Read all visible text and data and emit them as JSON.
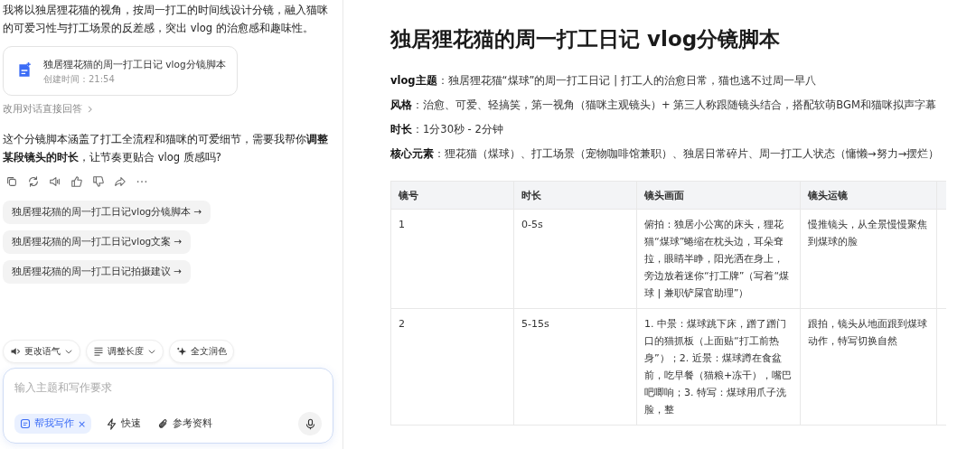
{
  "chat": {
    "intro": "我将以独居狸花猫的视角，按周一打工的时间线设计分镜，融入猫咪的可爱习性与打工场景的反差感，突出 vlog 的治愈感和趣味性。",
    "doc_card": {
      "title": "独居狸花猫的周一打工日记 vlog分镜脚本",
      "created": "创建时间：21:54"
    },
    "switch_link": "改用对话直接回答",
    "followup": "这个分镜脚本涵盖了打工全流程和猫咪的可爱细节，需要我帮你**调整某段镜头的时长**，让节奏更贴合 vlog 质感吗?",
    "actions": [
      {
        "kind": "copy"
      },
      {
        "kind": "regenerate"
      },
      {
        "kind": "speak"
      },
      {
        "kind": "like"
      },
      {
        "kind": "dislike"
      },
      {
        "kind": "share"
      },
      {
        "kind": "more"
      }
    ],
    "suggestions": [
      "独居狸花猫的周一打工日记vlog分镜脚本 →",
      "独居狸花猫的周一打工日记vlog文案 →",
      "独居狸花猫的周一打工日记拍摄建议 →"
    ]
  },
  "tools": [
    {
      "kind": "tone",
      "label": "更改语气"
    },
    {
      "kind": "length",
      "label": "调整长度"
    },
    {
      "kind": "polish",
      "label": "全文润色"
    }
  ],
  "composer": {
    "placeholder": "输入主题和写作要求",
    "mode_tag": {
      "label": "帮我写作",
      "close": "×"
    },
    "options": [
      {
        "kind": "fast",
        "label": "快速"
      },
      {
        "kind": "attach",
        "label": "参考资料"
      }
    ]
  },
  "document": {
    "title": "独居狸花猫的周一打工日记 vlog分镜脚本",
    "meta": [
      "**vlog主题**：独居狸花猫“煤球”的周一打工日记 | 打工人的治愈日常，猫也逃不过周一早八",
      "**风格**：治愈、可爱、轻搞笑，第一视角（猫咪主观镜头）+ 第三人称跟随镜头结合，搭配软萌BGM和猫咪拟声字幕",
      "**时长**：1分30秒 - 2分钟",
      "**核心元素**：狸花猫（煤球）、打工场景（宠物咖啡馆兼职）、独居日常碎片、周一打工人状态（慵懒→努力→摆烂）"
    ],
    "table": {
      "columns": [
        "镜号",
        "时长",
        "镜头画面",
        "镜头运镜"
      ],
      "rows": [
        [
          "1",
          "0-5s",
          "俯拍：独居小公寓的床头，狸花猫“煤球”蜷缩在枕头边，耳朵耷拉，眼睛半睁，阳光洒在身上，旁边放着迷你“打工牌”（写着“煤球 | 兼职铲屎官助理”）",
          "慢推镜头，从全景慢慢聚焦到煤球的脸"
        ],
        [
          "2",
          "5-15s",
          "1. 中景：煤球跳下床，蹭了蹭门口的猫抓板（上面贴“打工前热身”）；2. 近景：煤球蹲在食盆前，吃早餐（猫粮+冻干），嘴巴吧唧响；3. 特写：煤球用爪子洗脸，整",
          "跟拍，镜头从地面跟到煤球动作，特写切换自然"
        ]
      ]
    }
  }
}
